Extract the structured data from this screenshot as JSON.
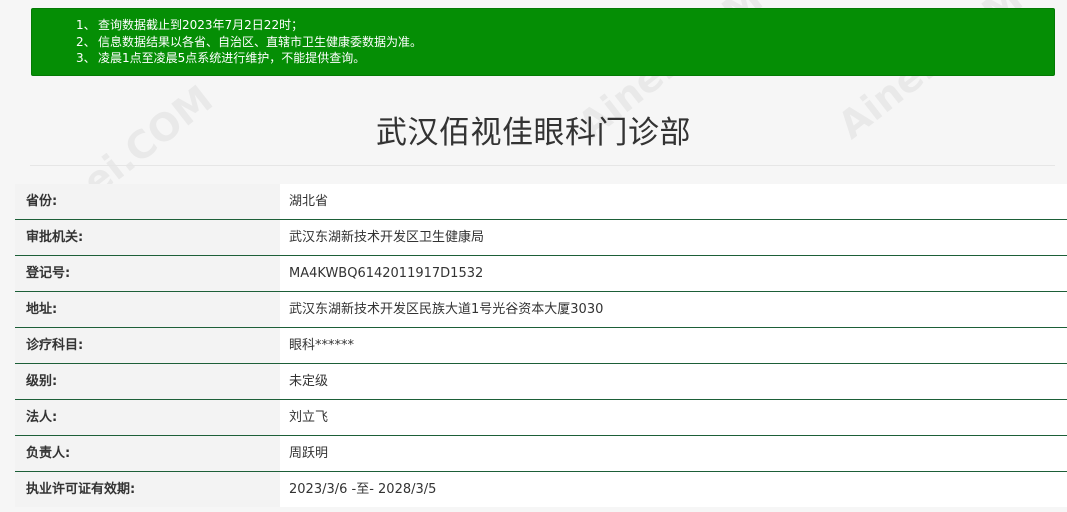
{
  "notice": {
    "items": [
      {
        "num": "1、",
        "text": "查询数据截止到2023年7月2日22时；"
      },
      {
        "num": "2、",
        "text": "信息数据结果以各省、自治区、直辖市卫生健康委数据为准。"
      },
      {
        "num": "3、",
        "text": "凌晨1点至凌晨5点系统进行维护，不能提供查询。"
      }
    ]
  },
  "page": {
    "title": "武汉佰视佳眼科门诊部"
  },
  "info_rows": [
    {
      "label": "省份:",
      "value": "湖北省"
    },
    {
      "label": "审批机关:",
      "value": "武汉东湖新技术开发区卫生健康局"
    },
    {
      "label": "登记号:",
      "value": "MA4KWBQ6142011917D1532"
    },
    {
      "label": "地址:",
      "value": "武汉东湖新技术开发区民族大道1号光谷资本大厦3030"
    },
    {
      "label": "诊疗科目:",
      "value": "眼科******"
    },
    {
      "label": "级别:",
      "value": "未定级"
    },
    {
      "label": "法人:",
      "value": "刘立飞"
    },
    {
      "label": "负责人:",
      "value": "周跃明"
    },
    {
      "label": "执业许可证有效期:",
      "value": "2023/3/6 -至- 2028/3/5"
    }
  ],
  "watermark": {
    "text": "Ainei.COM"
  },
  "colors": {
    "notice_bg": "#058e05",
    "row_border": "#1d5f38",
    "label_bg": "#f3f3f3"
  }
}
